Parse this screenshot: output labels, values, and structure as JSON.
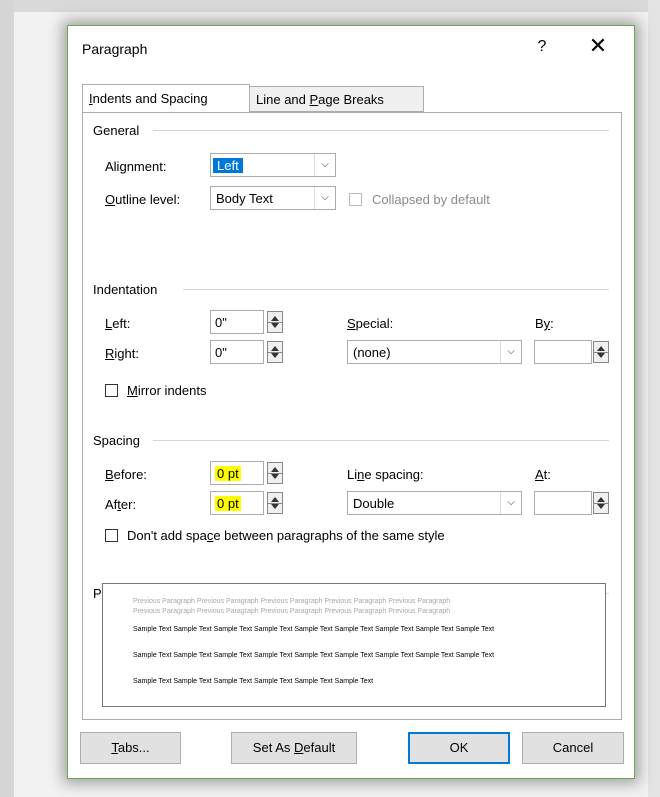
{
  "dialog": {
    "title": "Paragraph",
    "help_label": "?",
    "close_label": "✕"
  },
  "tabs": [
    {
      "label_parts": [
        "",
        "I",
        "ndents and Spacing"
      ],
      "active": true
    },
    {
      "label_parts": [
        "Line and ",
        "P",
        "age Breaks"
      ],
      "active": false
    }
  ],
  "general": {
    "heading": "General",
    "alignment_label": [
      "Ali",
      "g",
      "nment:"
    ],
    "alignment_value": "Left",
    "outline_label": [
      "",
      "O",
      "utline level:"
    ],
    "outline_value": "Body Text",
    "collapsed_label": "Collapsed by default"
  },
  "indentation": {
    "heading": "Indentation",
    "left_label": [
      "",
      "L",
      "eft:"
    ],
    "left_value": "0\"",
    "right_label": [
      "",
      "R",
      "ight:"
    ],
    "right_value": "0\"",
    "special_label": [
      "",
      "S",
      "pecial:"
    ],
    "special_value": "(none)",
    "by_label": [
      "B",
      "y",
      ":"
    ],
    "by_value": "",
    "mirror_label": [
      "",
      "M",
      "irror indents"
    ]
  },
  "spacing": {
    "heading": "Spacing",
    "before_label": [
      "",
      "B",
      "efore:"
    ],
    "before_value": "0 pt",
    "after_label": [
      "Af",
      "t",
      "er:"
    ],
    "after_value": "0 pt",
    "line_spacing_label": [
      "Li",
      "n",
      "e spacing:"
    ],
    "line_spacing_value": "Double",
    "at_label": [
      "",
      "A",
      "t:"
    ],
    "at_value": "",
    "dont_add_label": [
      "Don't add spa",
      "c",
      "e between paragraphs of the same style"
    ]
  },
  "preview": {
    "heading": "Preview",
    "prev_line_1": "Previous Paragraph Previous Paragraph Previous Paragraph Previous Paragraph Previous Paragraph",
    "prev_line_2": "Previous Paragraph Previous Paragraph Previous Paragraph Previous Paragraph Previous Paragraph",
    "sample_1": "Sample Text Sample Text Sample Text Sample Text Sample Text Sample Text Sample Text Sample Text Sample Text",
    "sample_2": "Sample Text Sample Text Sample Text Sample Text Sample Text Sample Text Sample Text Sample Text Sample Text",
    "sample_3": "Sample Text Sample Text Sample Text Sample Text Sample Text Sample Text"
  },
  "buttons": {
    "tabs": [
      "",
      "T",
      "abs..."
    ],
    "set_default": [
      "Set As ",
      "D",
      "efault"
    ],
    "ok": "OK",
    "cancel": "Cancel"
  },
  "colors": {
    "highlight": "#ffff00",
    "selection": "#0078d7",
    "dialog_border": "#6aa84f"
  }
}
